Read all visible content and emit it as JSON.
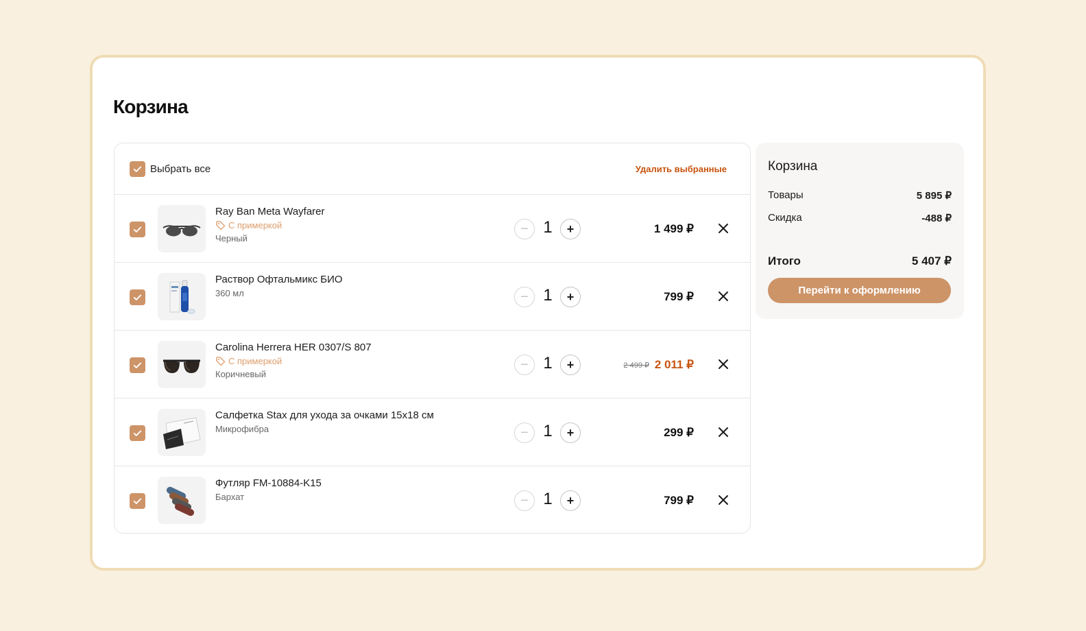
{
  "page": {
    "title": "Корзина"
  },
  "list_header": {
    "select_all": "Выбрать все",
    "delete_selected": "Удалить выбранные"
  },
  "items": [
    {
      "name": "Ray Ban Meta Wayfarer",
      "tag": "С примеркой",
      "variant": "Черный",
      "qty": "1",
      "price": "1 499 ₽",
      "old_price": "",
      "checked": true
    },
    {
      "name": "Раствор Офтальмикс БИО",
      "tag": "",
      "variant": "360 мл",
      "qty": "1",
      "price": "799 ₽",
      "old_price": "",
      "checked": true
    },
    {
      "name": "Carolina Herrera HER 0307/S 807",
      "tag": "С примеркой",
      "variant": "Коричневый",
      "qty": "1",
      "price": "2 011 ₽",
      "old_price": "2 499 ₽",
      "checked": true
    },
    {
      "name": "Салфетка Stax для ухода за очками 15x18 см",
      "tag": "",
      "variant": "Микрофибра",
      "qty": "1",
      "price": "299 ₽",
      "old_price": "",
      "checked": true
    },
    {
      "name": "Футляр FM-10884-K15",
      "tag": "",
      "variant": "Бархат",
      "qty": "1",
      "price": "799 ₽",
      "old_price": "",
      "checked": true
    }
  ],
  "summary": {
    "title": "Корзина",
    "goods_label": "Товары",
    "goods_value": "5 895 ₽",
    "discount_label": "Скидка",
    "discount_value": "-488 ₽",
    "total_label": "Итого",
    "total_value": "5 407 ₽",
    "checkout_label": "Перейти к оформлению"
  },
  "colors": {
    "accent": "#cd9468",
    "discount": "#c8540f",
    "tag": "#dd9c6a",
    "background": "#f9f0df"
  }
}
